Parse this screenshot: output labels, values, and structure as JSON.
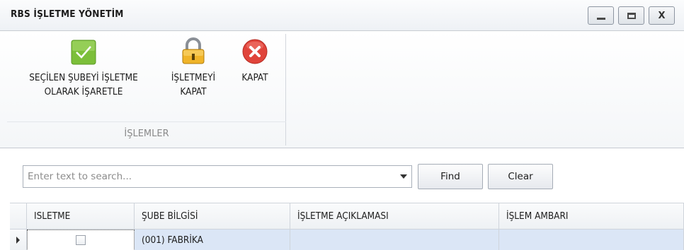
{
  "window": {
    "title": "RBS İŞLETME YÖNETİM",
    "controls": [
      "minimize-icon",
      "maximize-icon",
      "close-icon"
    ],
    "close_glyph": "X"
  },
  "ribbon": {
    "buttons": [
      {
        "label_line1": "SEÇİLEN ŞUBEYİ İŞLETME",
        "label_line2": "OLARAK İŞARETLE",
        "icon": "checkmark-icon",
        "color": "#7cbf3a"
      },
      {
        "label_line1": "İŞLETMEYİ",
        "label_line2": "KAPAT",
        "icon": "padlock-icon",
        "color": "#e2a81f"
      },
      {
        "label_line1": "KAPAT",
        "label_line2": "",
        "icon": "close-circle-icon",
        "color": "#e0443b"
      }
    ],
    "group_label": "İŞLEMLER"
  },
  "search": {
    "placeholder": "Enter text to search...",
    "find_label": "Find",
    "clear_label": "Clear"
  },
  "grid": {
    "columns": [
      "ISLETME",
      "ŞUBE BİLGİSİ",
      "İŞLETME AÇIKLAMASI",
      "İŞLEM AMBARI"
    ],
    "rows": [
      {
        "isletme_checked": false,
        "sube": "(001) FABRİKA",
        "aciklama": "",
        "ambar": ""
      }
    ],
    "selected_row_color": "#dbe6f6"
  }
}
